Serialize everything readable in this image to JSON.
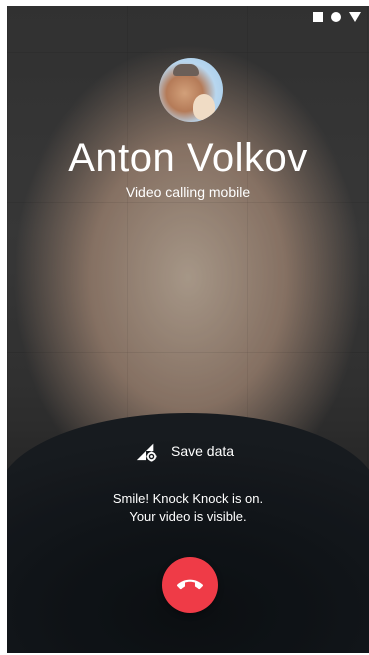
{
  "status_bar": {
    "icons": [
      "square-icon",
      "circle-icon",
      "triangle-down-icon"
    ]
  },
  "caller": {
    "name": "Anton Volkov",
    "subtitle": "Video calling mobile",
    "avatar_icon": "profile-photo"
  },
  "controls": {
    "save_data_label": "Save data",
    "save_data_icon": "signal-gear-icon",
    "end_call_icon": "phone-hangup-icon"
  },
  "notice": {
    "line1": "Smile! Knock Knock is on.",
    "line2": "Your video is visible."
  },
  "colors": {
    "end_call": "#ef3b47",
    "text": "#ffffff"
  }
}
